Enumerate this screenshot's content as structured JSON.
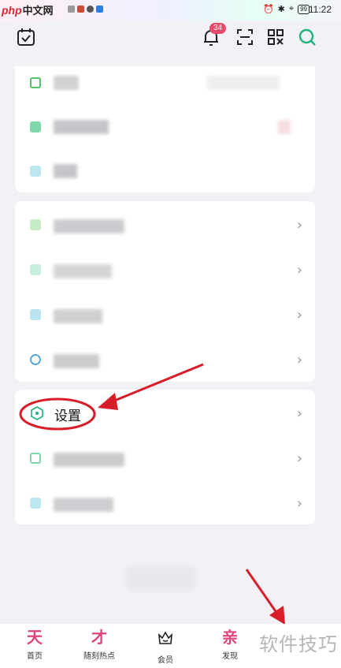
{
  "status_bar": {
    "logo_text": "php",
    "logo_cn": "中文网",
    "time": "11:22",
    "battery": "99"
  },
  "top_bar": {
    "notification_count": "34"
  },
  "settings_row": {
    "label": "设置"
  },
  "bottom_nav": {
    "items": [
      {
        "glyph": "天",
        "label": "首页"
      },
      {
        "glyph": "才",
        "label": "随刻热点"
      },
      {
        "glyph": "",
        "label": "会员"
      },
      {
        "glyph": "亲",
        "label": "发现"
      }
    ]
  },
  "watermark": "软件技巧",
  "colors": {
    "accent_green": "#1fb37a",
    "annotation_red": "#d81e28",
    "nav_pink": "#e0457a"
  }
}
